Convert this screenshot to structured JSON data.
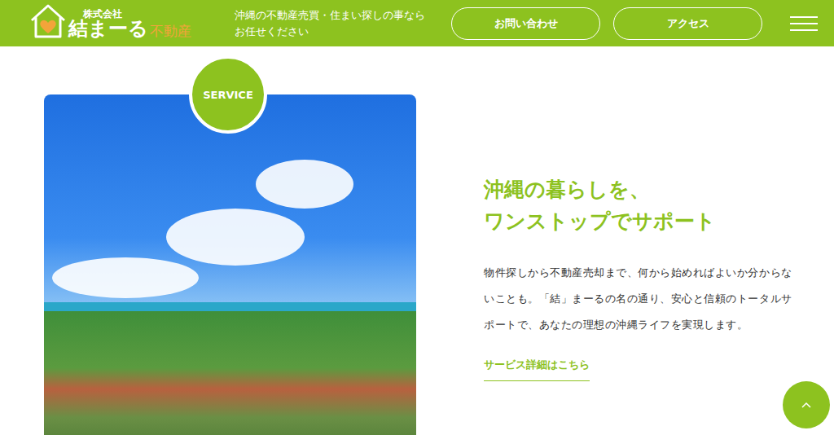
{
  "header": {
    "logo": {
      "company_type": "株式会社",
      "name": "結まーる",
      "suffix": "不動産"
    },
    "tagline": "沖縄の不動産売買・住まい探しの事ならお任せください",
    "buttons": [
      "お問い合わせ",
      "アクセス"
    ]
  },
  "service": {
    "badge": "SERVICE",
    "heading_lines": [
      "沖縄の暮らしを、",
      "ワンストップでサポート"
    ],
    "body": "物件探しから不動産売却まで、何から始めればよいか分からないことも。「結」まーるの名の通り、安心と信頼のトータルサポートで、あなたの理想の沖縄ライフを実現します。",
    "link": "サービス詳細はこちら"
  }
}
